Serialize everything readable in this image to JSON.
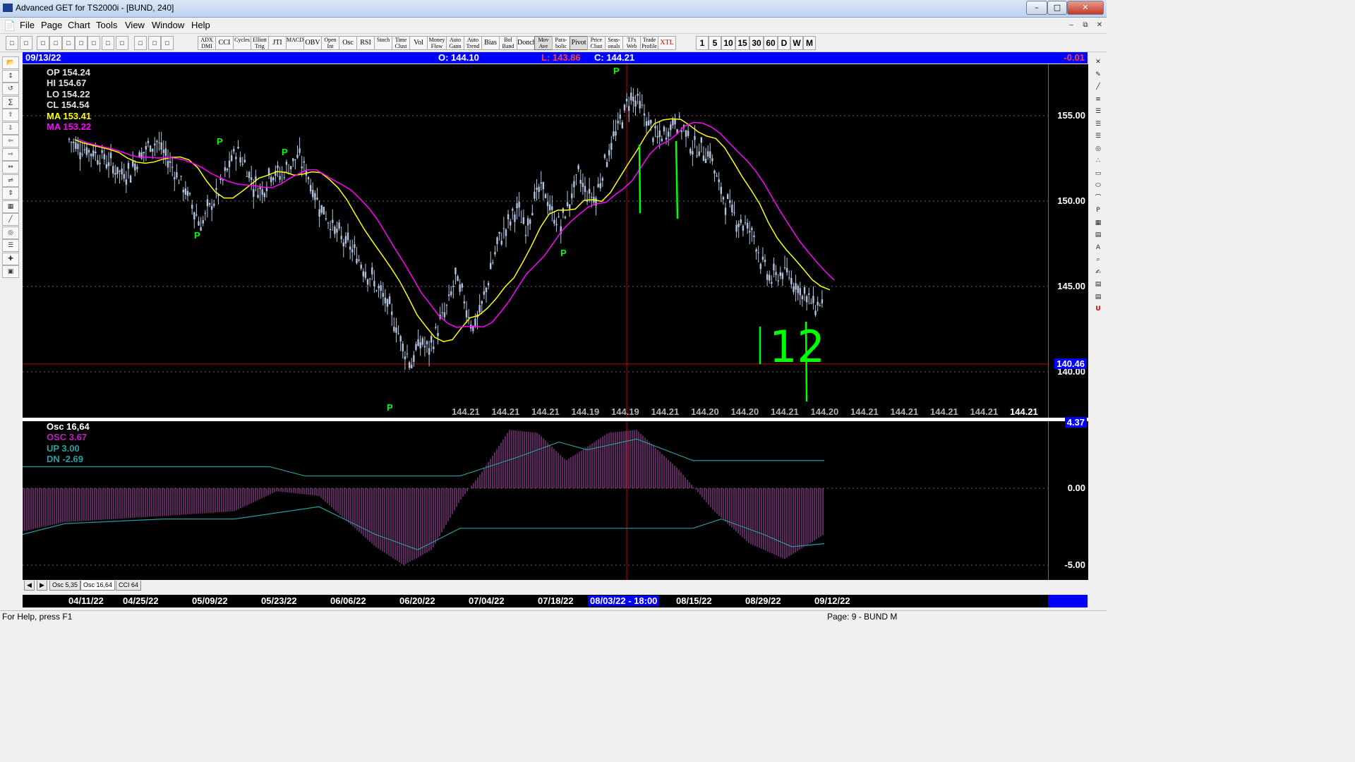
{
  "window": {
    "title": "Advanced GET for TS2000i - [BUND, 240]",
    "min": "–",
    "max": "□",
    "close": "✕"
  },
  "menu": [
    "File",
    "Page",
    "Chart",
    "Tools",
    "View",
    "Window",
    "Help"
  ],
  "toolbar": {
    "studies": [
      "ADX DMI",
      "CCI",
      "Cycles",
      "Elliott Trig",
      "JTI",
      "MACD",
      "OBV",
      "Open Int",
      "Osc",
      "RSI",
      "Stoch",
      "Time Clust",
      "Vol",
      "Money Flow",
      "Auto Gann",
      "Auto Trend",
      "Bias",
      "Bol Band",
      "Donch",
      "Mov Ave",
      "Para-bolic",
      "Pivot",
      "Price Clust",
      "Seas-onals",
      "TJ's Web",
      "Trade Profile",
      "XTL"
    ],
    "periods": [
      "1",
      "5",
      "10",
      "15",
      "30",
      "60",
      "D",
      "W",
      "M"
    ]
  },
  "infobar": {
    "date": "09/13/22",
    "open": "O: 144.10",
    "low": "L: 143.86",
    "close": "C: 144.21",
    "change": "-0.01"
  },
  "price_stats": {
    "op": "OP  154.24",
    "hi": "HI   154.67",
    "lo": "LO  154.22",
    "cl": "CL  154.54",
    "ma1": "MA  153.41",
    "ma2": "MA  153.22"
  },
  "osc_stats": {
    "title": "Osc 16,64",
    "osc": "OSC 3.67",
    "up": "UP   3.00",
    "dn": "DN   -2.69"
  },
  "price_axis": [
    "155.00",
    "150.00",
    "145.00",
    "140.00"
  ],
  "price_line_label": "140.46",
  "osc_axis": [
    "4.37",
    "0.00",
    "-5.00"
  ],
  "bottom_values": [
    "144.21",
    "144.21",
    "144.21",
    "144.19",
    "144.19",
    "144.21",
    "144.20",
    "144.20",
    "144.21",
    "144.20",
    "144.21",
    "144.21",
    "144.21",
    "144.21",
    "144.21"
  ],
  "pivot_label": "P",
  "annotation": "12",
  "tabs": [
    "Osc 5,35",
    "Osc 16,64",
    "CCI 64"
  ],
  "dates": [
    "04/11/22",
    "04/25/22",
    "05/09/22",
    "05/23/22",
    "06/06/22",
    "06/20/22",
    "07/04/22",
    "07/18/22",
    "08/03/22 - 18:00",
    "08/15/22",
    "08/29/22",
    "09/12/22"
  ],
  "status": {
    "left": "For Help, press F1",
    "right": "Page: 9 - BUND M"
  },
  "colors": {
    "ma_fast": "#ffff00",
    "ma_slow": "#ff00ff",
    "candles": "#b0c4e0",
    "pivot": "#00ff00",
    "osc": "#a040a0",
    "osc_bands": "#2a9a9a"
  },
  "chart_data": {
    "type": "candlestick",
    "symbol": "BUND",
    "ylim": [
      138,
      157
    ],
    "close_series": [
      153.6,
      153.2,
      153.0,
      152.8,
      152.5,
      152.0,
      151.6,
      151.8,
      152.6,
      153.2,
      153.5,
      152.6,
      151.8,
      150.8,
      149.8,
      148.6,
      149.6,
      150.5,
      151.8,
      153.0,
      152.2,
      151.0,
      150.6,
      151.8,
      151.5,
      152.0,
      152.6,
      151.8,
      150.3,
      149.4,
      148.5,
      147.8,
      147.3,
      146.6,
      145.8,
      145.0,
      144.1,
      143.0,
      141.5,
      140.5,
      141.8,
      141.2,
      142.6,
      143.7,
      145.5,
      144.2,
      142.6,
      143.8,
      146.0,
      147.8,
      148.6,
      149.6,
      148.4,
      150.2,
      150.8,
      149.2,
      148.6,
      150.0,
      151.5,
      150.4,
      150.2,
      152.3,
      153.6,
      155.0,
      156.2,
      155.6,
      154.5,
      153.6,
      154.0,
      154.8,
      154.2,
      153.2,
      153.0,
      152.8,
      150.8,
      149.8,
      149.0,
      148.6,
      148.0,
      146.2,
      145.4,
      145.8,
      145.6,
      145.0,
      144.3,
      143.9,
      144.2
    ]
  }
}
